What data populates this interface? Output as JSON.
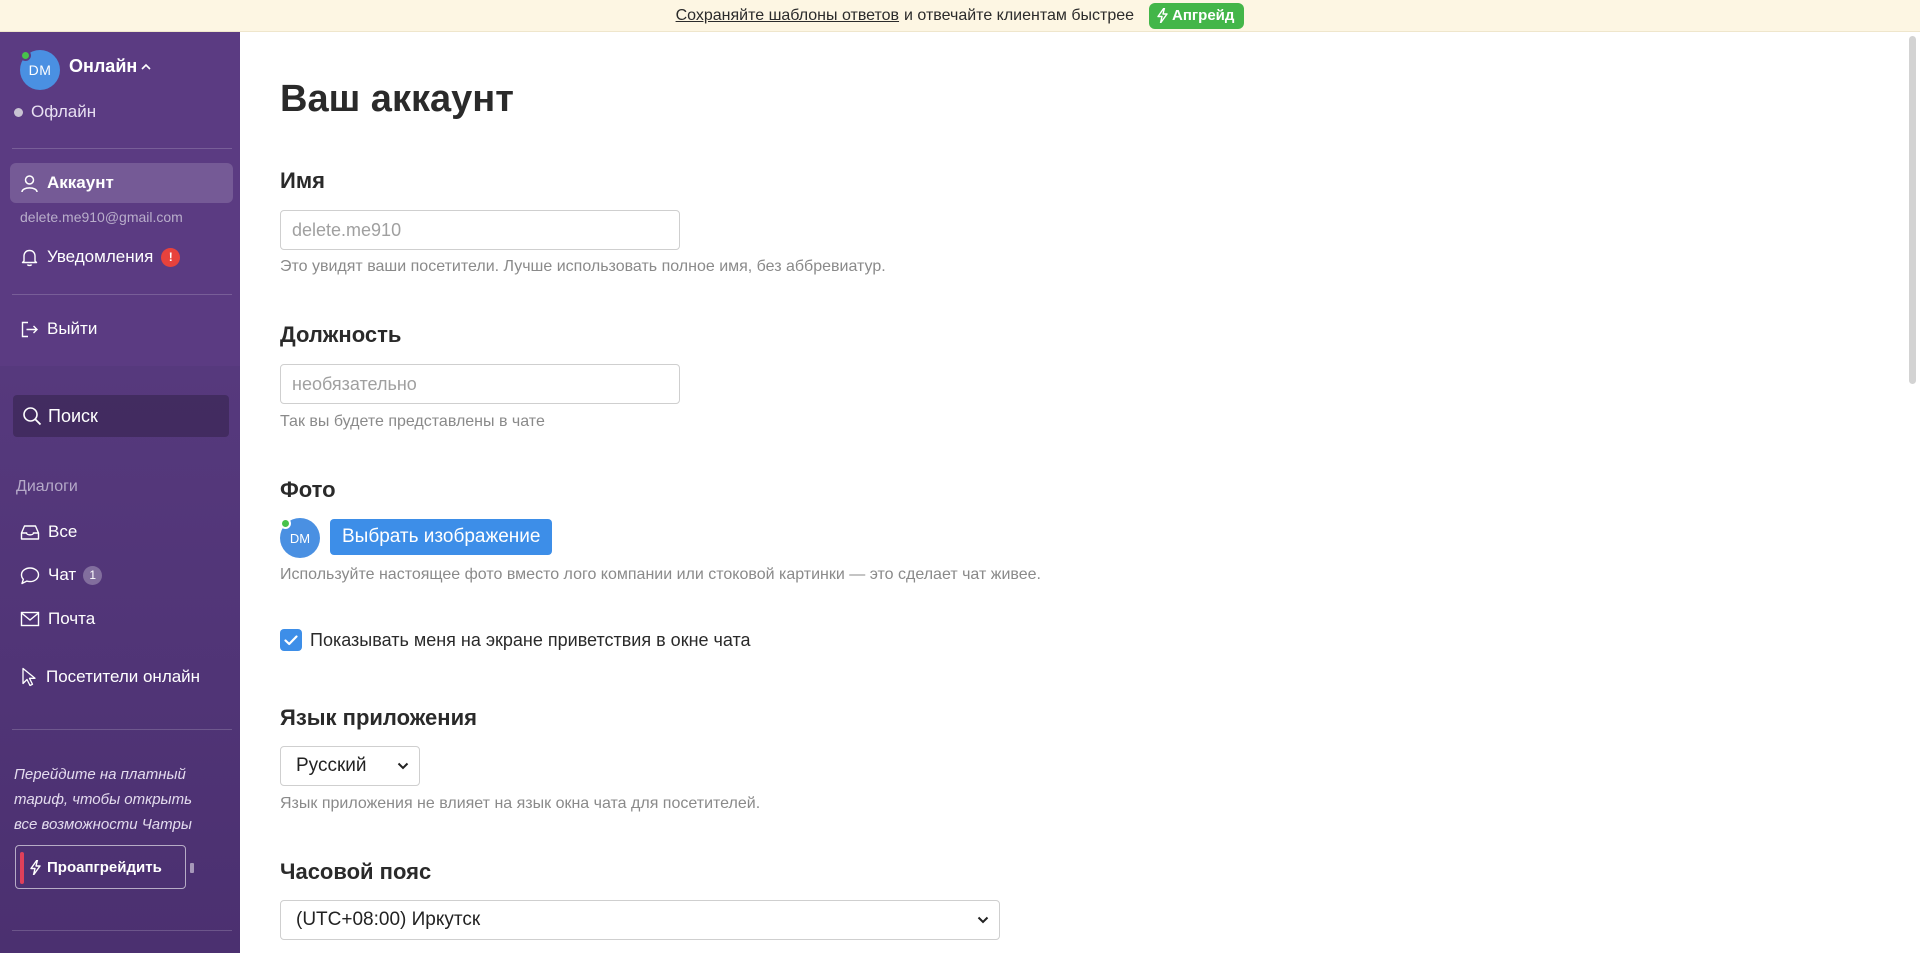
{
  "banner": {
    "link_text": "Сохраняйте шаблоны ответов",
    "rest_text": "и отвечайте клиентам быстрее",
    "upgrade_label": "Апгрейд"
  },
  "sidebar": {
    "avatar_initials": "DM",
    "status_current": "Онлайн",
    "status_alternative": "Офлайн",
    "account_label": "Аккаунт",
    "account_email": "delete.me910@gmail.com",
    "notifications_label": "Уведомления",
    "notifications_badge": "!",
    "logout_label": "Выйти",
    "search_label": "Поиск",
    "dialogs_section": "Диалоги",
    "nav_all": "Все",
    "nav_chat": "Чат",
    "nav_chat_count": "1",
    "nav_mail": "Почта",
    "nav_visitors": "Посетители онлайн",
    "promo_text": "Перейдите на платный тариф, чтобы открыть все возможности Чатры",
    "promo_button": "Проапгрейдить"
  },
  "main": {
    "title": "Ваш аккаунт",
    "name": {
      "label": "Имя",
      "placeholder": "delete.me910",
      "value": "",
      "hint": "Это увидят ваши посетители. Лучше использовать полное имя, без аббревиатур."
    },
    "position": {
      "label": "Должность",
      "placeholder": "необязательно",
      "value": "",
      "hint": "Так вы будете представлены в чате"
    },
    "photo": {
      "label": "Фото",
      "avatar_initials": "DM",
      "choose_button": "Выбрать изображение",
      "hint": "Используйте настоящее фото вместо лого компании или стоковой картинки — это сделает чат живее.",
      "show_on_welcome_label": "Показывать меня на экране приветствия в окне чата",
      "show_on_welcome_checked": true
    },
    "language": {
      "label": "Язык приложения",
      "selected": "Русский",
      "hint": "Язык приложения не влияет на язык окна чата для посетителей."
    },
    "timezone": {
      "label": "Часовой пояс",
      "selected": "(UTC+08:00) Иркутск"
    }
  },
  "colors": {
    "sidebar_bg": "#4a2f6b",
    "accent_blue": "#3d8ee8",
    "online_green": "#48c24b",
    "upgrade_green": "#43b649",
    "badge_red": "#e8423c"
  }
}
